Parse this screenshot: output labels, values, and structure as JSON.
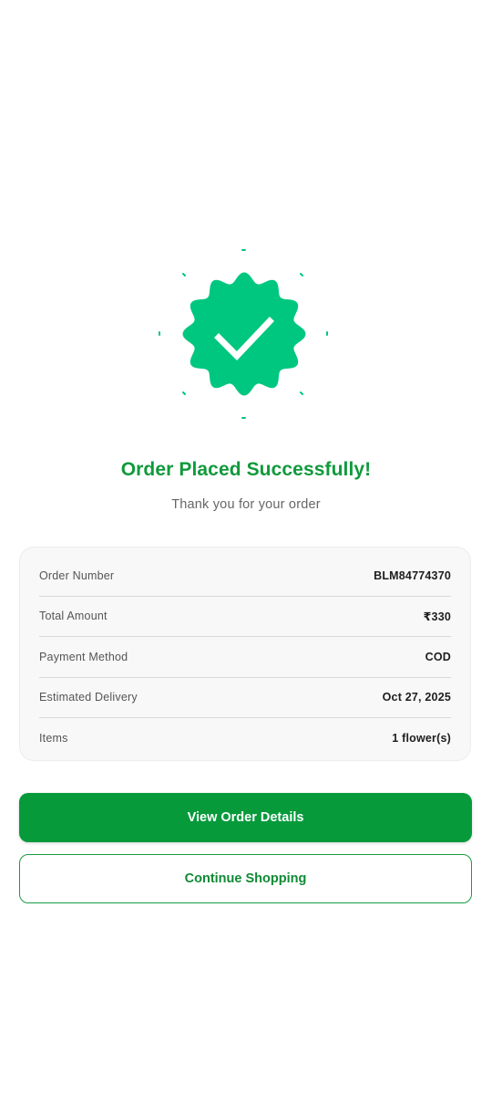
{
  "colors": {
    "accent": "#00c77f",
    "title_green": "#109a3c",
    "primary_button": "#069a3b"
  },
  "success": {
    "badge_icon": "check-badge-icon",
    "title": "Order Placed Successfully!",
    "subtitle": "Thank you for your order"
  },
  "order_summary": {
    "rows": [
      {
        "label": "Order Number",
        "value": "BLM84774370"
      },
      {
        "label": "Total Amount",
        "value": "₹330"
      },
      {
        "label": "Payment Method",
        "value": "COD"
      },
      {
        "label": "Estimated Delivery",
        "value": "Oct 27, 2025"
      },
      {
        "label": "Items",
        "value": "1 flower(s)"
      }
    ]
  },
  "actions": {
    "view_details_label": "View Order Details",
    "continue_label": "Continue Shopping"
  }
}
